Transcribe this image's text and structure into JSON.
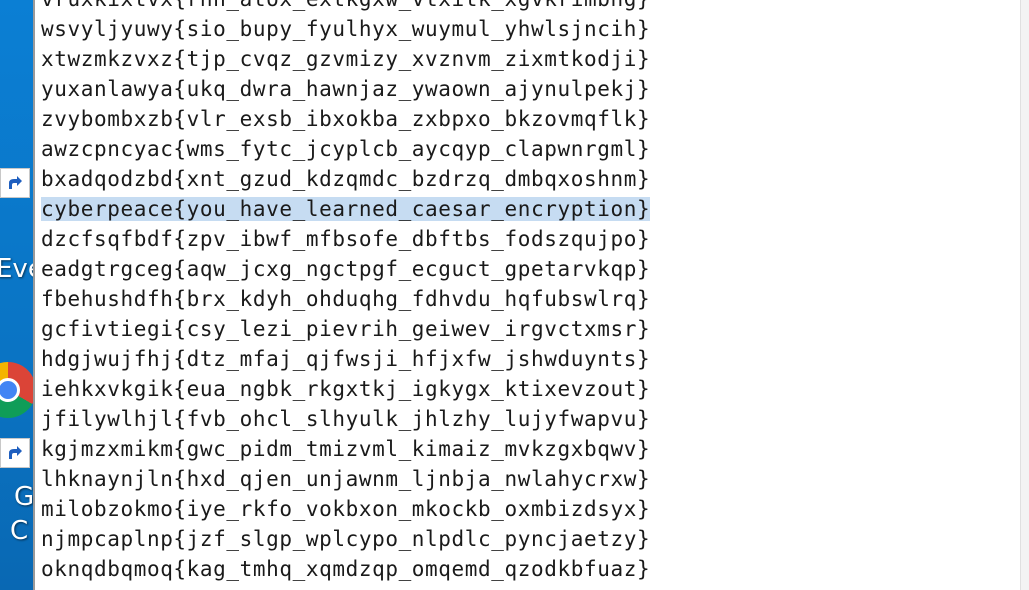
{
  "desktop": {
    "labels": {
      "eve": "Eve",
      "g": "G",
      "c": "C"
    },
    "icons": [
      "shortcut-arrow-icon",
      "shortcut-arrow-icon",
      "chrome-icon"
    ]
  },
  "editor": {
    "lines": [
      "vruxkixtvx{rnn_atox_extkgxw_vtxitk_xgvkrimbng}",
      "wsvyljyuwy{sio_bupy_fyulhyx_wuymul_yhwlsjncih}",
      "xtwzmkzvxz{tjp_cvqz_gzvmizy_xvznvm_zixmtkodji}",
      "yuxanlawya{ukq_dwra_hawnjaz_ywaown_ajynulpekj}",
      "zvybombxzb{vlr_exsb_ibxokba_zxbpxo_bkzovmqflk}",
      "awzcpncyac{wms_fytc_jcyplcb_aycqyp_clapwnrgml}",
      "bxadqodzbd{xnt_gzud_kdzqmdc_bzdrzq_dmbqxoshnm}",
      "cyberpeace{you_have_learned_caesar_encryption}",
      "dzcfsqfbdf{zpv_ibwf_mfbsofe_dbftbs_fodszqujpo}",
      "eadgtrgceg{aqw_jcxg_ngctpgf_ecguct_gpetarvkqp}",
      "fbehushdfh{brx_kdyh_ohduqhg_fdhvdu_hqfubswlrq}",
      "gcfivtiegi{csy_lezi_pievrih_geiwev_irgvctxmsr}",
      "hdgjwujfhj{dtz_mfaj_qjfwsji_hfjxfw_jshwduynts}",
      "iehkxvkgik{eua_ngbk_rkgxtkj_igkygx_ktixevzout}",
      "jfilywlhjl{fvb_ohcl_slhyulk_jhlzhy_lujyfwapvu}",
      "kgjmzxmikm{gwc_pidm_tmizvml_kimaiz_mvkzgxbqwv}",
      "lhknaynjln{hxd_qjen_unjawnm_ljnbja_nwlahycrxw}",
      "milobzokmo{iye_rkfo_vokbxon_mkockb_oxmbizdsyx}",
      "njmpcaplnp{jzf_slgp_wplcypo_nlpdlc_pyncjaetzy}",
      "oknqdbqmoq{kag_tmhq_xqmdzqp_omqemd_qzodkbfuaz}"
    ],
    "selected_line": "cyberpeace{you_have_learned_caesar_encryption}"
  }
}
